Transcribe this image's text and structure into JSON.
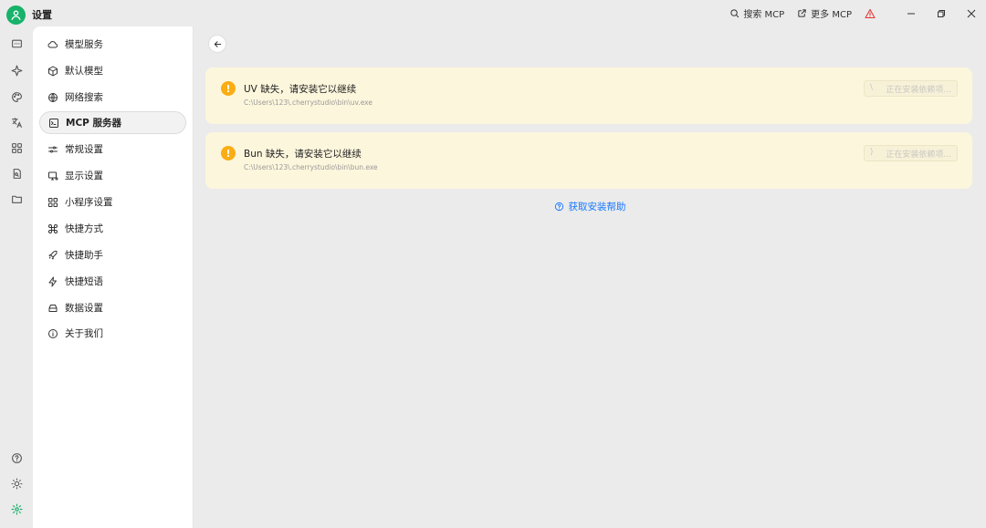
{
  "app": {
    "title": "设置"
  },
  "titlebar": {
    "search_mcp": "搜索 MCP",
    "more_mcp": "更多 MCP"
  },
  "nav": {
    "items": [
      {
        "label": "模型服务",
        "icon": "cloud-icon"
      },
      {
        "label": "默认模型",
        "icon": "cube-icon"
      },
      {
        "label": "网络搜索",
        "icon": "globe-icon"
      },
      {
        "label": "MCP 服务器",
        "icon": "terminal-icon",
        "active": true
      },
      {
        "label": "常规设置",
        "icon": "settings-sliders-icon"
      },
      {
        "label": "显示设置",
        "icon": "monitor-icon"
      },
      {
        "label": "小程序设置",
        "icon": "grid-icon"
      },
      {
        "label": "快捷方式",
        "icon": "command-icon"
      },
      {
        "label": "快捷助手",
        "icon": "rocket-icon"
      },
      {
        "label": "快捷短语",
        "icon": "zap-icon"
      },
      {
        "label": "数据设置",
        "icon": "hard-drive-icon"
      },
      {
        "label": "关于我们",
        "icon": "info-icon"
      }
    ]
  },
  "main": {
    "cards": [
      {
        "title": "UV 缺失，请安装它以继续",
        "path": "C:\\Users\\123\\.cherrystudio\\bin\\uv.exe",
        "button": "正在安装依赖项...",
        "spinner": "\\"
      },
      {
        "title": "Bun 缺失，请安装它以继续",
        "path": "C:\\Users\\123\\.cherrystudio\\bin\\bun.exe",
        "button": "正在安装依赖项...",
        "spinner": "⟩"
      }
    ],
    "help_link": "获取安装帮助"
  },
  "colors": {
    "accent": "#1677ff",
    "brand": "#18b26b",
    "warning": "#faad14",
    "alert": "#e53935",
    "card_bg": "#fcf6dc"
  }
}
